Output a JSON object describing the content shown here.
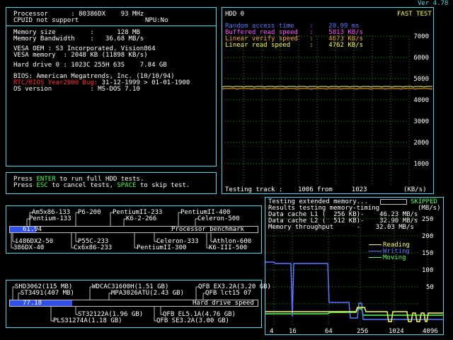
{
  "version": "Ver 4.78",
  "sysinfo": {
    "processor": "Processor      : 80386DX    93 MHz",
    "cpuid": "CPUID not support",
    "npu": "NPU:No",
    "memory_size": "Memory size         :      128 MB",
    "memory_bandwidth": "Memory Bandwidth    :   36.68 MB/s",
    "vesa_oem": "VESA OEM : S3 Incorporated. Vision864",
    "vesa_memory": "VESA memory  : 2048 KB (11898 KB/s)",
    "hard_drive": "Hard drive 0 : 1023C 255H 63S    7.84 GB",
    "bios": "BIOS: American Megatrends, Inc. (10/10/94)",
    "y2k_label": "RTC/BIOS Year2000 Bug:",
    "y2k_value": " 31-12-1999 > 01-01-1900",
    "os_version": "OS version          : MS-DOS 7.10"
  },
  "instructions": {
    "l1a": "Press ",
    "l1b": "ENTER",
    "l1c": " to run full HDD tests.",
    "l2a": "Press ",
    "l2b": "ESC",
    "l2c": " to cancel tests, ",
    "l2d": "SPACE",
    "l2e": " to skip test."
  },
  "hdd": {
    "title": "HDD 0",
    "mode": "FAST TEST",
    "random_access": "Random access time    :    20.99 ms",
    "buffered_read": "Buffered read speed   :    5813 KB/s",
    "linear_verify": "Linear verify speed   :    4673 KB/s",
    "linear_read": "Linear read speed     :    4762 KB/s",
    "testing_track": "Testing track :    1006 from     1023",
    "unit": "(KB/s)",
    "y_ticks": [
      "7000",
      "6000",
      "5000",
      "4000",
      "3000",
      "2000",
      "1000"
    ]
  },
  "cpu_bench": {
    "value": "61.94",
    "label": "Processor benchmark",
    "progress": 0.104,
    "top_refs": [
      {
        "text": "Am5x86-133"
      },
      {
        "text": "P6-200"
      },
      {
        "text": "PentiumII-233"
      },
      {
        "text": "PentiumII-400"
      },
      {
        "text": "Pentium-133"
      },
      {
        "text": "K6-2-266"
      },
      {
        "text": "Celeron-500"
      }
    ],
    "bottom_refs": [
      {
        "text": "i486DX2-50"
      },
      {
        "text": "P55C-233"
      },
      {
        "text": "Celeron-333"
      },
      {
        "text": "Athlon-600"
      },
      {
        "text": "386DX-40"
      },
      {
        "text": "Cx6x86-233"
      },
      {
        "text": "PentiumII-300"
      },
      {
        "text": "K6-III-500"
      }
    ]
  },
  "hdd_bench": {
    "value": "77.18",
    "label": "Hard drive speed",
    "progress": 0.25,
    "top_refs": [
      {
        "text": "SHD3062(115 MB)"
      },
      {
        "text": "WDCAC31600H(1.51 GB)"
      },
      {
        "text": "QFB EX3.2A(3.20 GB)"
      },
      {
        "text": "ST3491(407 MB)"
      },
      {
        "text": "MPA3026ATU(2.43 GB)"
      },
      {
        "text": "QFB lct15 07"
      }
    ],
    "bottom_refs": [
      {
        "text": "ST32122A(1.96 GB)"
      },
      {
        "text": "QFB EL5.1A(4.76 GB)"
      },
      {
        "text": "PLS31274A(1.18 GB)"
      },
      {
        "text": "QFB SE3.2A(3.00 GB)"
      }
    ]
  },
  "memory": {
    "testing": "Testing extended memory...",
    "skipped": "SKIPPED",
    "results": "Results testing memory-timing",
    "unit": "(MB/s)",
    "l1": "Data cache L1 (  256 KB)-    46.23 MB/s",
    "l2": "Data cache L2 (  512 KB)-    32.90 MB/s",
    "throughput": "Memory throughput      -    32.03 MB/s",
    "y_ticks": [
      "250",
      "200",
      "150",
      "100",
      "50"
    ],
    "legend": [
      "Reading",
      "Writing",
      "Moving"
    ],
    "x_ticks": [
      "4",
      "16",
      "64",
      "256",
      "1024",
      "4096"
    ]
  },
  "colors": {
    "border": "#55d6e6",
    "reading": "#ffff55",
    "writing": "#5a78ff",
    "moving": "#55ff55",
    "hdd_line": "#ffaa33",
    "grid": "#2aa22a"
  }
}
